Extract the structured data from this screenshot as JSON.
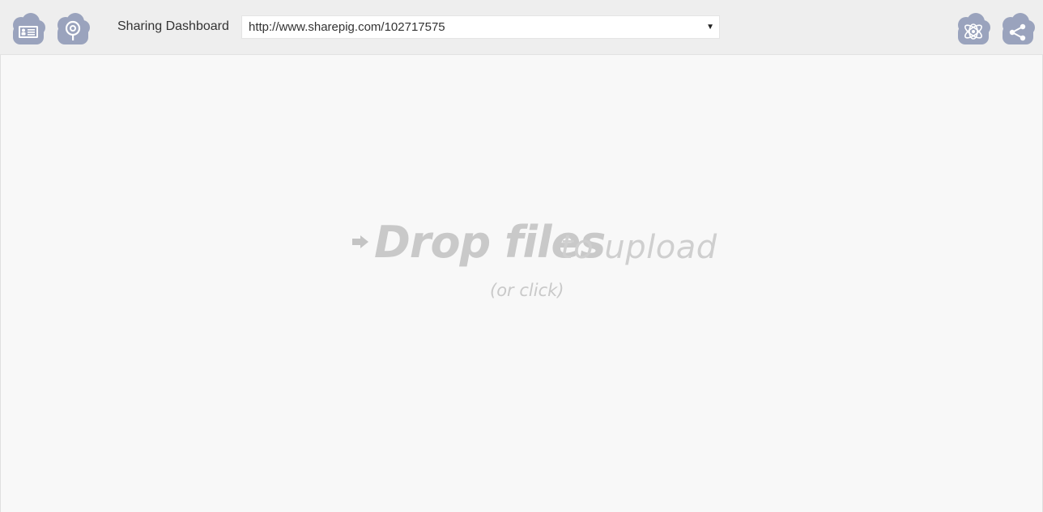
{
  "header": {
    "title": "Sharing Dashboard",
    "left_icons": [
      "id-card-icon",
      "location-pin-icon"
    ],
    "right_icons": [
      "atom-icon",
      "share-icon"
    ],
    "icon_color": "#9aa3bd"
  },
  "url_select": {
    "value": "http://www.sharepig.com/102717575",
    "arrow": "▼"
  },
  "dropzone": {
    "strong": "Drop files",
    "light": "to upload",
    "sub": "(or click)",
    "text_color": "#c9c9c9",
    "background": "#f8f8f8"
  }
}
